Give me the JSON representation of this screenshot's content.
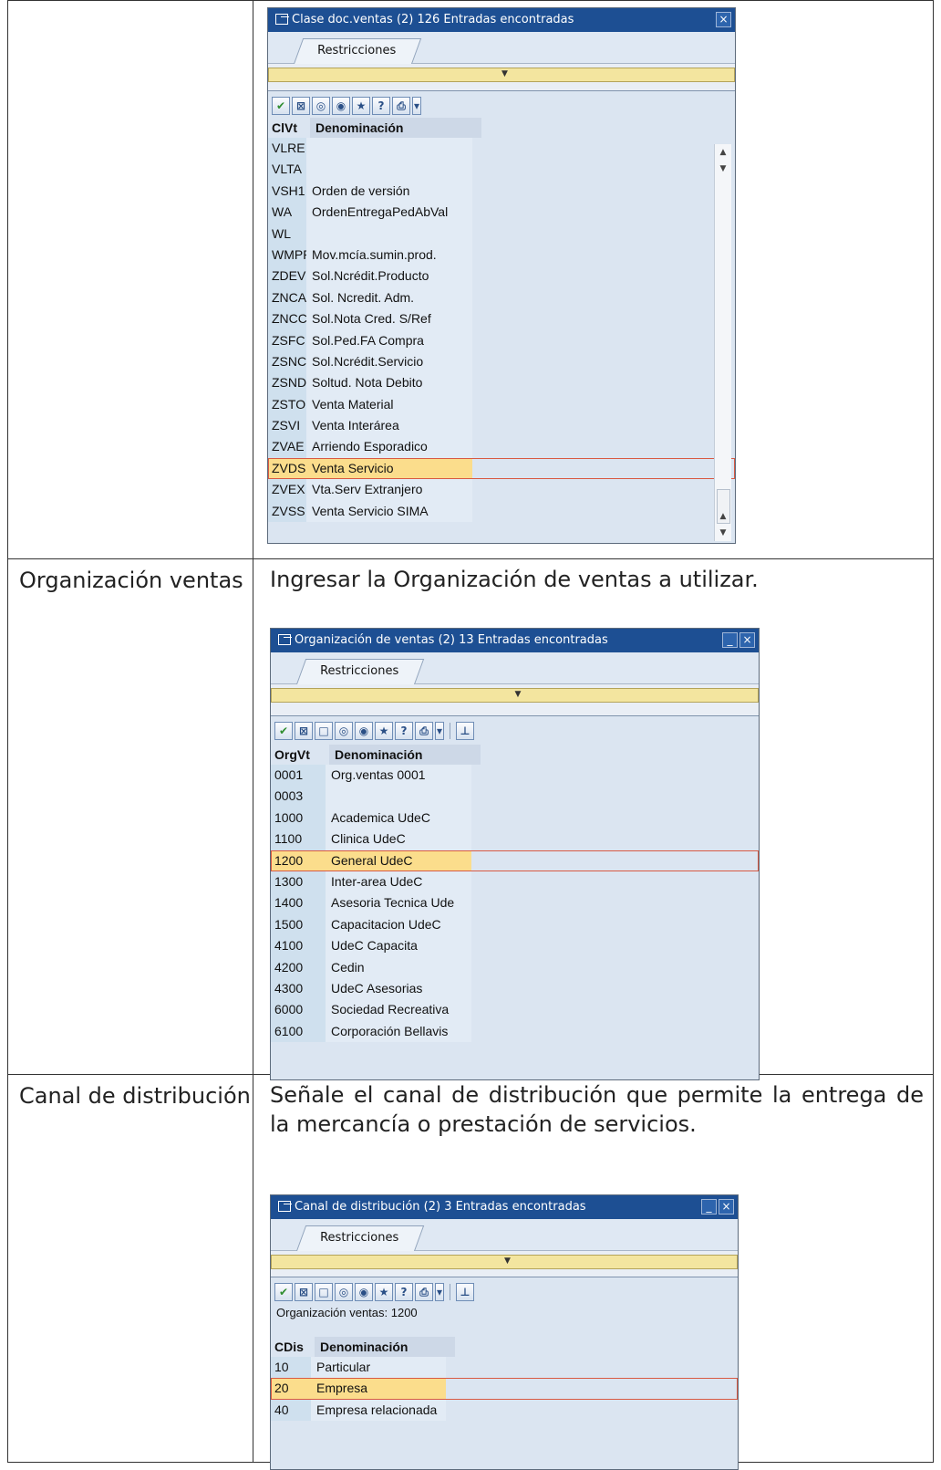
{
  "rows": [
    {
      "label": "",
      "description": ""
    },
    {
      "label": "Organización ventas",
      "description": "Ingresar la Organización de ventas a utilizar."
    },
    {
      "label": "Canal de distribución",
      "description": "Señale el canal de distribución que permite la entrega de la mercancía o prestación de servicios."
    }
  ],
  "dialog_clase": {
    "title": "Clase doc.ventas (2)  126 Entradas encontradas",
    "tab": "Restricciones",
    "col1": "ClVt",
    "col2": "Denominación",
    "items": [
      {
        "code": "VLRE",
        "name": ""
      },
      {
        "code": "VLTA",
        "name": ""
      },
      {
        "code": "VSH1",
        "name": "Orden de versión"
      },
      {
        "code": "WA",
        "name": "OrdenEntregaPedAbVal"
      },
      {
        "code": "WL",
        "name": ""
      },
      {
        "code": "WMPP",
        "name": "Mov.mcía.sumin.prod."
      },
      {
        "code": "ZDEV",
        "name": "Sol.Ncrédit.Producto"
      },
      {
        "code": "ZNCA",
        "name": "Sol. Ncredit. Adm."
      },
      {
        "code": "ZNCC",
        "name": "Sol.Nota Cred. S/Ref"
      },
      {
        "code": "ZSFC",
        "name": "Sol.Ped.FA Compra"
      },
      {
        "code": "ZSNC",
        "name": "Sol.Ncrédit.Servicio"
      },
      {
        "code": "ZSND",
        "name": "Soltud. Nota Debito"
      },
      {
        "code": "ZSTO",
        "name": "Venta Material"
      },
      {
        "code": "ZSVI",
        "name": "Venta Interárea"
      },
      {
        "code": "ZVAE",
        "name": "Arriendo Esporadico"
      },
      {
        "code": "ZVDS",
        "name": "Venta Servicio"
      },
      {
        "code": "ZVEX",
        "name": "Vta.Serv  Extranjero"
      },
      {
        "code": "ZVSS",
        "name": "Venta Servicio SIMA"
      }
    ],
    "selected_index": 15
  },
  "dialog_org": {
    "title": "Organización de ventas (2)   13 Entradas encontradas",
    "tab": "Restricciones",
    "col1": "OrgVt",
    "col2": "Denominación",
    "items": [
      {
        "code": "0001",
        "name": "Org.ventas 0001"
      },
      {
        "code": "0003",
        "name": ""
      },
      {
        "code": "1000",
        "name": "Academica UdeC"
      },
      {
        "code": "1100",
        "name": "Clinica UdeC"
      },
      {
        "code": "1200",
        "name": "General UdeC"
      },
      {
        "code": "1300",
        "name": "Inter-area UdeC"
      },
      {
        "code": "1400",
        "name": "Asesoria Tecnica Ude"
      },
      {
        "code": "1500",
        "name": "Capacitacion UdeC"
      },
      {
        "code": "4100",
        "name": "UdeC Capacita"
      },
      {
        "code": "4200",
        "name": "Cedin"
      },
      {
        "code": "4300",
        "name": "UdeC Asesorias"
      },
      {
        "code": "6000",
        "name": "Sociedad Recreativa"
      },
      {
        "code": "6100",
        "name": "Corporación Bellavis"
      }
    ],
    "selected_index": 4
  },
  "dialog_canal": {
    "title": "Canal de distribución (2)    3 Entradas encontradas",
    "tab": "Restricciones",
    "info": "Organización ventas: 1200",
    "col1": "CDis",
    "col2": "Denominación",
    "items": [
      {
        "code": "10",
        "name": "Particular"
      },
      {
        "code": "20",
        "name": "Empresa"
      },
      {
        "code": "40",
        "name": "Empresa relacionada"
      }
    ],
    "selected_index": 1
  },
  "icons": {
    "toolbar_full": [
      "check-icon",
      "cancel-icon",
      "new-entries-icon",
      "find-icon",
      "find-next-icon",
      "favorites-icon",
      "help-icon",
      "print-icon",
      "dropdown-icon"
    ],
    "toolbar_short": [
      "check-icon",
      "cancel-icon",
      "find-icon",
      "find-next-icon",
      "favorites-icon",
      "help-icon",
      "print-icon",
      "dropdown-icon"
    ]
  },
  "colors": {
    "titlebar": "#1d4f93",
    "selection": "#fbdd8c",
    "collapse_bar": "#f3e59f"
  }
}
